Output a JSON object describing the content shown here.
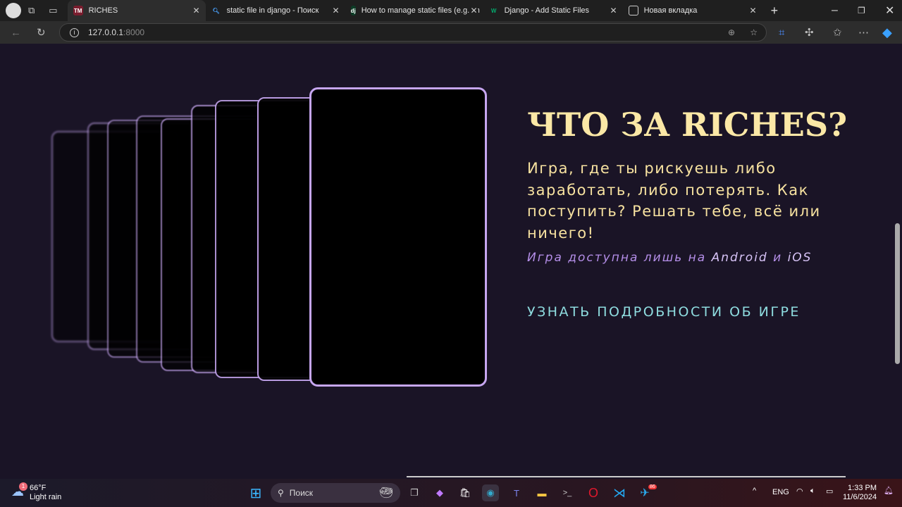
{
  "browser": {
    "tabs": [
      {
        "label": "RICHES",
        "favicon": "TM",
        "active": true
      },
      {
        "label": "static file in django - Поиск",
        "favicon": "search-icon"
      },
      {
        "label": "How to manage static files (e.g. im",
        "favicon": "dj"
      },
      {
        "label": "Django - Add Static Files",
        "favicon": "W"
      },
      {
        "label": "Новая вкладка",
        "favicon": "newtab-icon"
      }
    ],
    "url_host": "127.0.0.1",
    "url_port": ":8000"
  },
  "page": {
    "title": "ЧТО ЗА RICHES?",
    "description": "Игра, где ты рискуешь либо заработать, либо потерять. Как поступить? Решать тебе, всё или ничего!",
    "availability_prefix": "Игра доступна лишь на ",
    "platform_android": "Android",
    "availability_and": " и ",
    "platform_ios": "iOS",
    "more_link": "УЗНАТЬ ПОДРОБНОСТИ ОБ ИГРЕ",
    "colors": {
      "bg": "#1a1426",
      "title": "#fbe8a6",
      "accent": "#c6a6f0",
      "link": "#8fdde0"
    }
  },
  "taskbar": {
    "weather_temp": "66°F",
    "weather_desc": "Light rain",
    "weather_badge": "1",
    "search_placeholder": "Поиск",
    "language": "ENG",
    "time": "1:33 PM",
    "date": "11/6/2024",
    "telegram_badge": "86"
  }
}
